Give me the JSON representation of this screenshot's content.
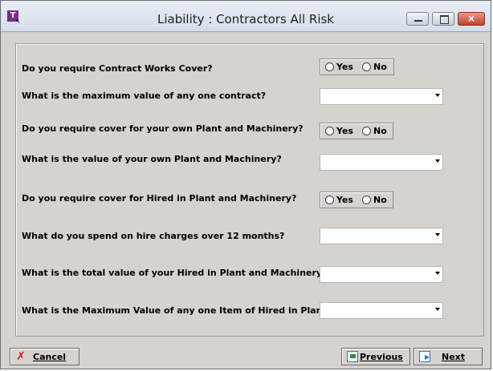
{
  "window": {
    "title": "Liability : Contractors All Risk",
    "app_icon_letter": "T"
  },
  "titlebar_buttons": {
    "minimize": "minimize-icon",
    "maximize": "maximize-icon",
    "close": "×"
  },
  "questions": [
    {
      "label": "Do you require Contract Works Cover?",
      "type": "radio",
      "options": [
        "Yes",
        "No"
      ],
      "selected": null
    },
    {
      "label": "What is the maximum value of any one contract?",
      "type": "combo",
      "value": ""
    },
    {
      "label": "Do you require cover for your own Plant and Machinery?",
      "type": "radio",
      "options": [
        "Yes",
        "No"
      ],
      "selected": null
    },
    {
      "label": "What is the value of your own Plant and Machinery?",
      "type": "combo",
      "value": ""
    },
    {
      "label": "Do you require cover for Hired in Plant and Machinery?",
      "type": "radio",
      "options": [
        "Yes",
        "No"
      ],
      "selected": null
    },
    {
      "label": "What do you spend on hire charges over 12 months?",
      "type": "combo",
      "value": ""
    },
    {
      "label": "What is the total value of your Hired in Plant and Machinery?",
      "type": "combo",
      "value": ""
    },
    {
      "label": "What is the Maximum Value of any one Item of Hired in Plant?",
      "type": "combo",
      "value": ""
    }
  ],
  "footer": {
    "cancel_label": "Cancel",
    "previous_label": "Previous",
    "next_label": "Next"
  },
  "colors": {
    "window_bg": "#d6d3ce",
    "close_button": "#c2402c",
    "app_icon": "#7b2a8e"
  }
}
